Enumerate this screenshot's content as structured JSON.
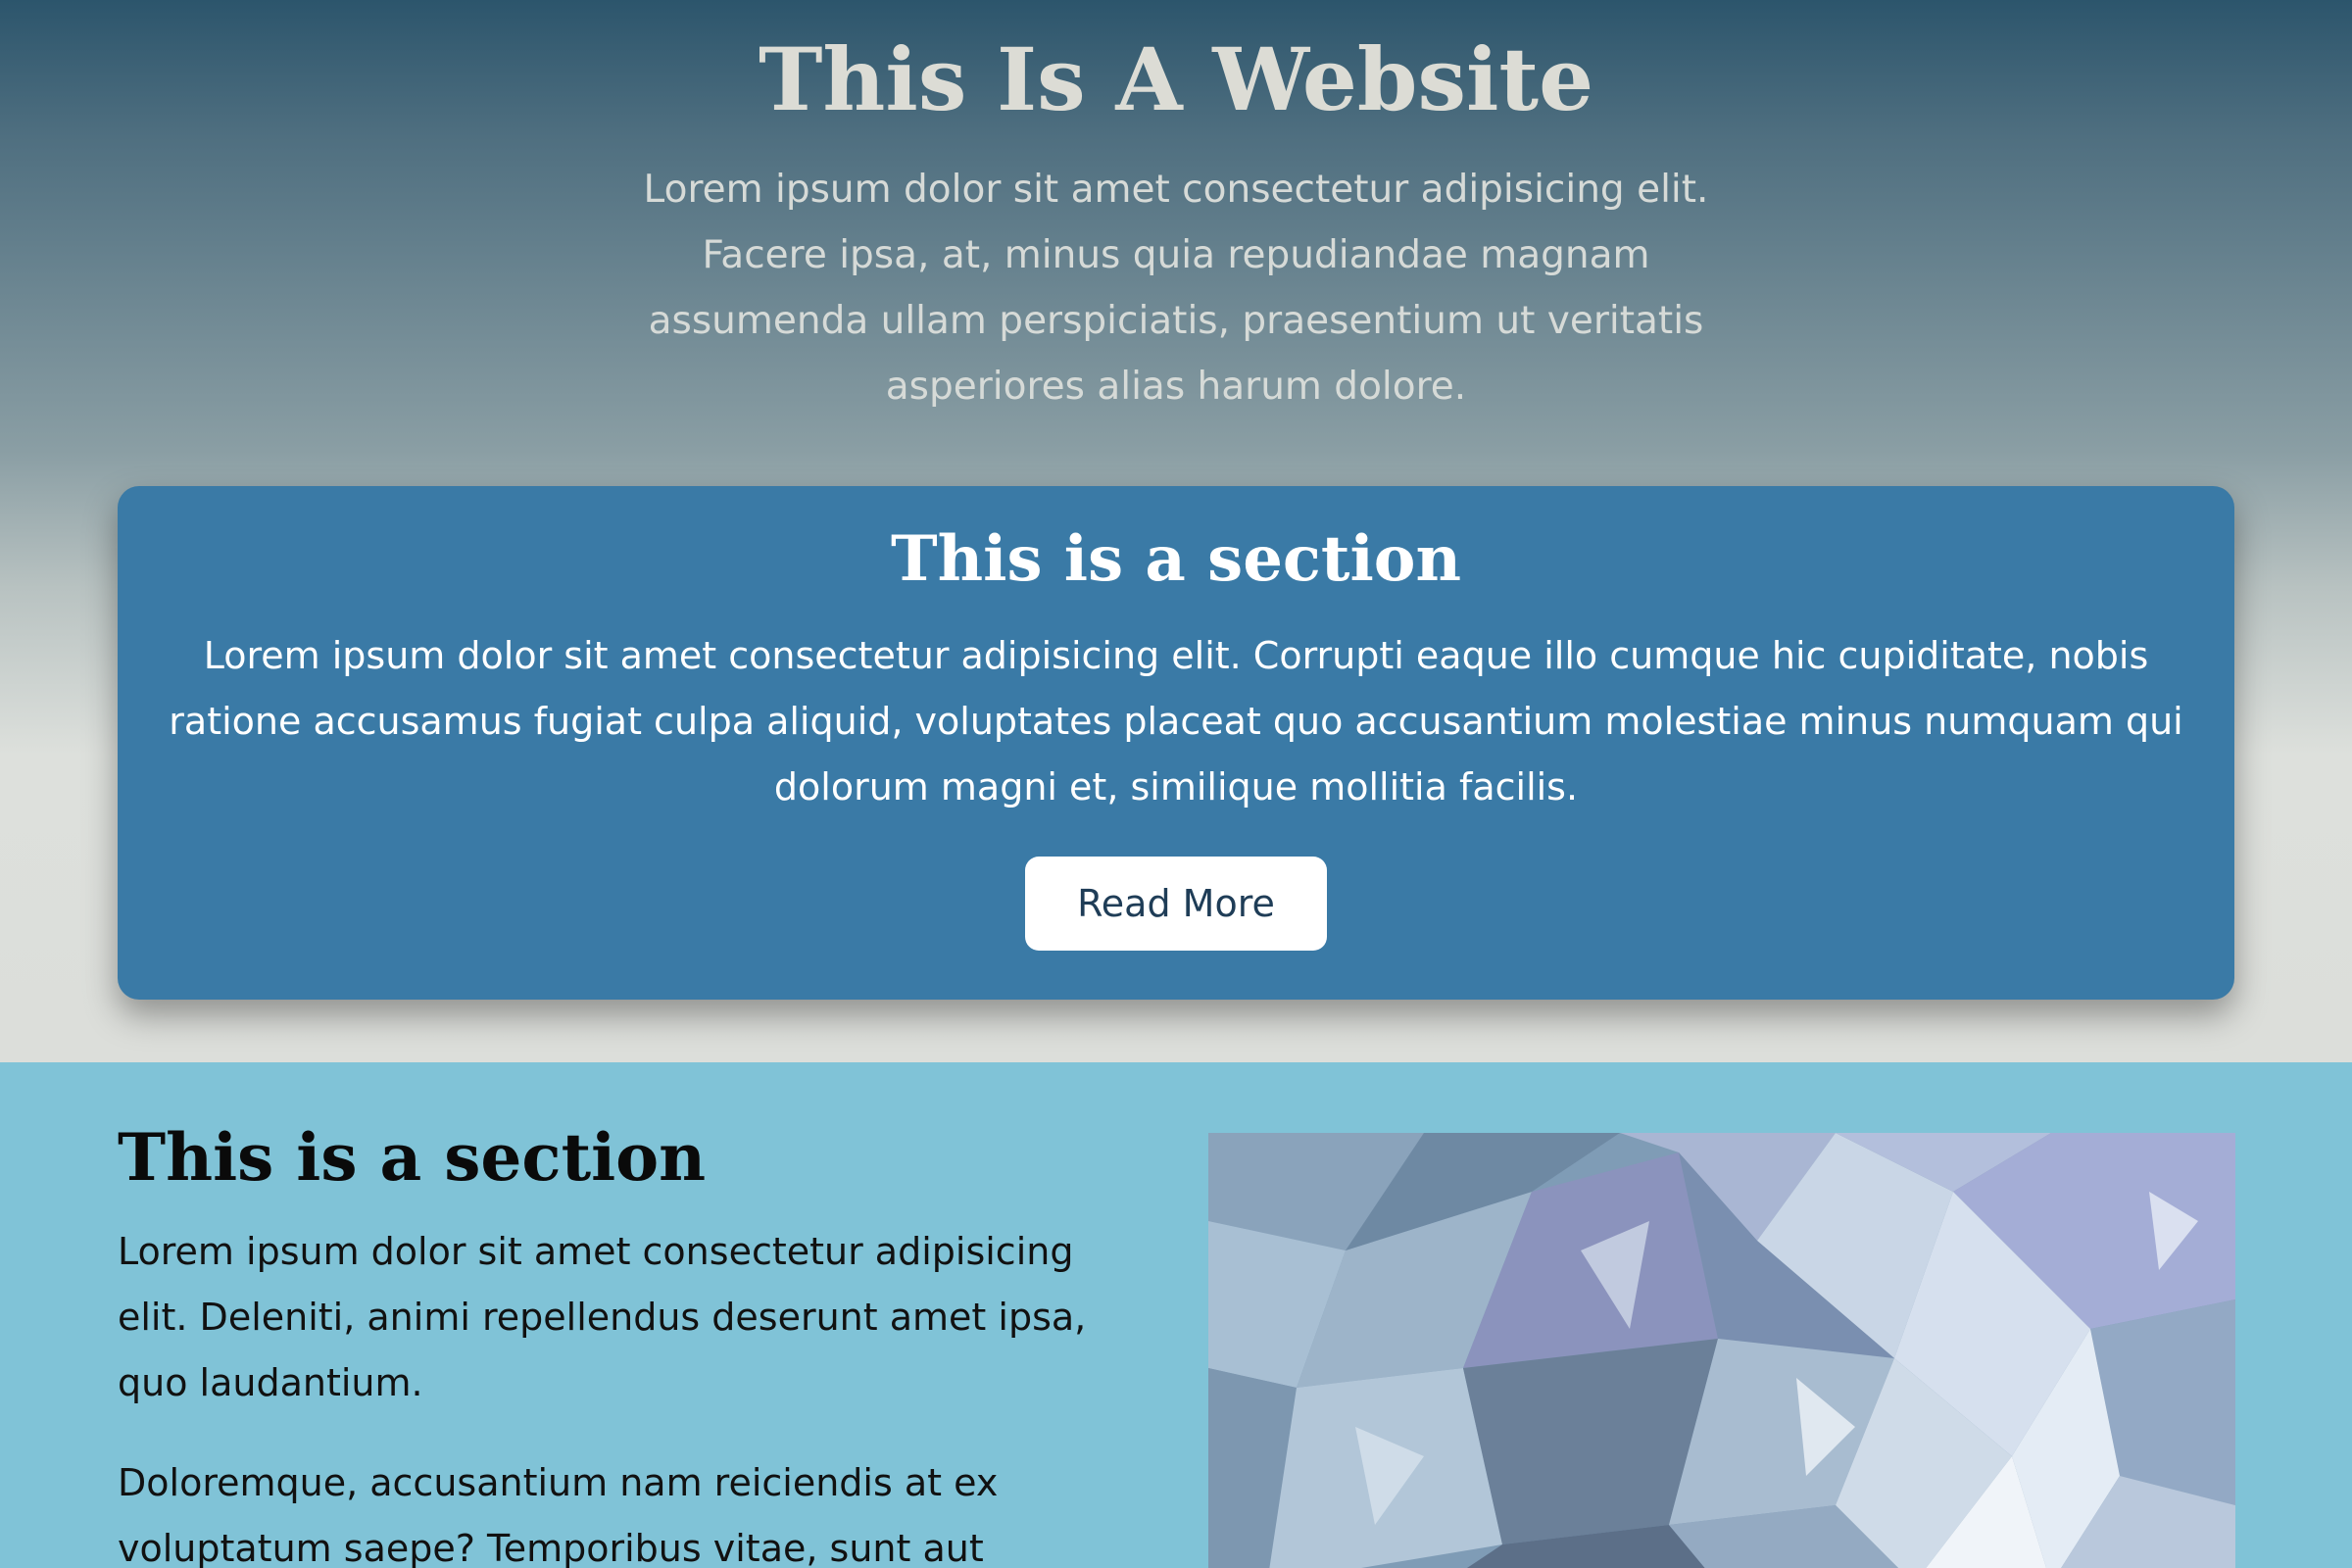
{
  "hero": {
    "title": "This Is A Website",
    "text": "Lorem ipsum dolor sit amet consectetur adipisicing elit. Facere ipsa, at, minus quia repudiandae magnam assumenda ullam perspiciatis, praesentium ut veritatis asperiores alias harum dolore."
  },
  "card": {
    "title": "This is a section",
    "text": "Lorem ipsum dolor sit amet consectetur adipisicing elit. Corrupti eaque illo cumque hic cupiditate, nobis ratione accusamus fugiat culpa aliquid, voluptates placeat quo accusantium molestiae minus numquam qui dolorum magni et, similique mollitia facilis.",
    "button_label": "Read More",
    "background": "#3a7aa6"
  },
  "section2": {
    "title": "This is a section",
    "paragraph1": "Lorem ipsum dolor sit amet consectetur adipisicing elit. Deleniti, animi repellendus deserunt amet ipsa, quo laudantium.",
    "paragraph2": "Doloremque, accusantium nam reiciendis at ex voluptatum saepe? Temporibus vitae, sunt aut",
    "background": "#80c3d7",
    "image_icon": "crystal-image"
  }
}
